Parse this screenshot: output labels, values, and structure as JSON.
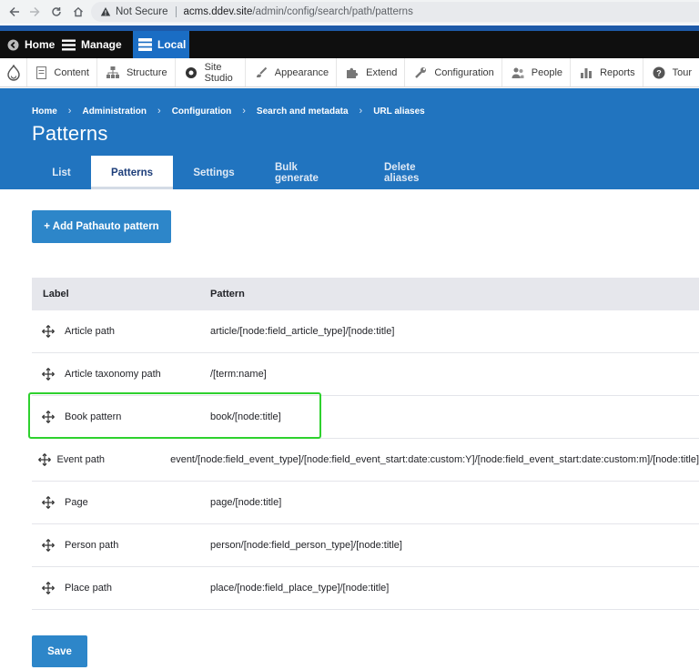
{
  "browser": {
    "security_label": "Not Secure",
    "url_host": "acms.ddev.site",
    "url_path": "/admin/config/search/path/patterns"
  },
  "toolbar": {
    "home": "Home",
    "manage": "Manage",
    "local": "Local"
  },
  "admin_menu": {
    "items": [
      "Content",
      "Structure",
      "Site Studio",
      "Appearance",
      "Extend",
      "Configuration",
      "People",
      "Reports",
      "Tour"
    ]
  },
  "breadcrumb": [
    "Home",
    "Administration",
    "Configuration",
    "Search and metadata",
    "URL aliases"
  ],
  "page_title": "Patterns",
  "tabs": [
    "List",
    "Patterns",
    "Settings",
    "Bulk generate",
    "Delete aliases"
  ],
  "active_tab": "Patterns",
  "add_button": "+ Add Pathauto pattern",
  "table": {
    "headers": {
      "label": "Label",
      "pattern": "Pattern"
    },
    "rows": [
      {
        "label": "Article path",
        "pattern": "article/[node:field_article_type]/[node:title]"
      },
      {
        "label": "Article taxonomy path",
        "pattern": "/[term:name]"
      },
      {
        "label": "Book pattern",
        "pattern": "book/[node:title]"
      },
      {
        "label": "Event path",
        "pattern": "event/[node:field_event_type]/[node:field_event_start:date:custom:Y]/[node:field_event_start:date:custom:m]/[node:title]"
      },
      {
        "label": "Page",
        "pattern": "page/[node:title]"
      },
      {
        "label": "Person path",
        "pattern": "person/[node:field_person_type]/[node:title]"
      },
      {
        "label": "Place path",
        "pattern": "place/[node:field_place_type]/[node:title]"
      }
    ]
  },
  "save_button": "Save",
  "colors": {
    "header_blue": "#2174bf",
    "button_blue": "#2d86c9",
    "highlight_green": "#2ed12e",
    "toolbar_black": "#0f0f0f",
    "local_blue": "#1a6dc4"
  }
}
